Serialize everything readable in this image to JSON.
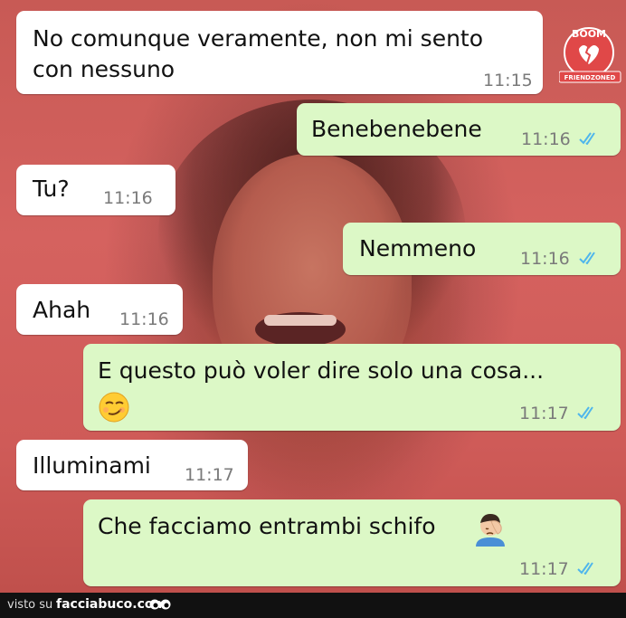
{
  "colors": {
    "incoming_bubble": "#ffffff",
    "outgoing_bubble": "#dcf8c6",
    "read_ticks": "#4fb6ec",
    "background": "#cf5b58"
  },
  "messages": [
    {
      "dir": "in",
      "text": "No comunque veramente, non mi sento",
      "text2": "con nessuno",
      "time": "11:15"
    },
    {
      "dir": "out",
      "text": "Benebenebene",
      "time": "11:16",
      "status": "read"
    },
    {
      "dir": "in",
      "text": "Tu?",
      "time": "11:16"
    },
    {
      "dir": "out",
      "text": "Nemmeno",
      "time": "11:16",
      "status": "read"
    },
    {
      "dir": "in",
      "text": "Ahah",
      "time": "11:16"
    },
    {
      "dir": "out",
      "text": "E questo può voler dire solo una cosa...",
      "emoji": "smirking-face",
      "time": "11:17",
      "status": "read"
    },
    {
      "dir": "in",
      "text": "Illuminami",
      "time": "11:17"
    },
    {
      "dir": "out",
      "text": "Che facciamo entrambi schifo",
      "emoji": "man-facepalming",
      "time": "11:17",
      "status": "read"
    }
  ],
  "watermark": {
    "logo_top": "BOOM",
    "logo_bottom": "FRIENDZONED"
  },
  "footer": {
    "prefix": "visto su",
    "site": "facciabuco.com"
  }
}
